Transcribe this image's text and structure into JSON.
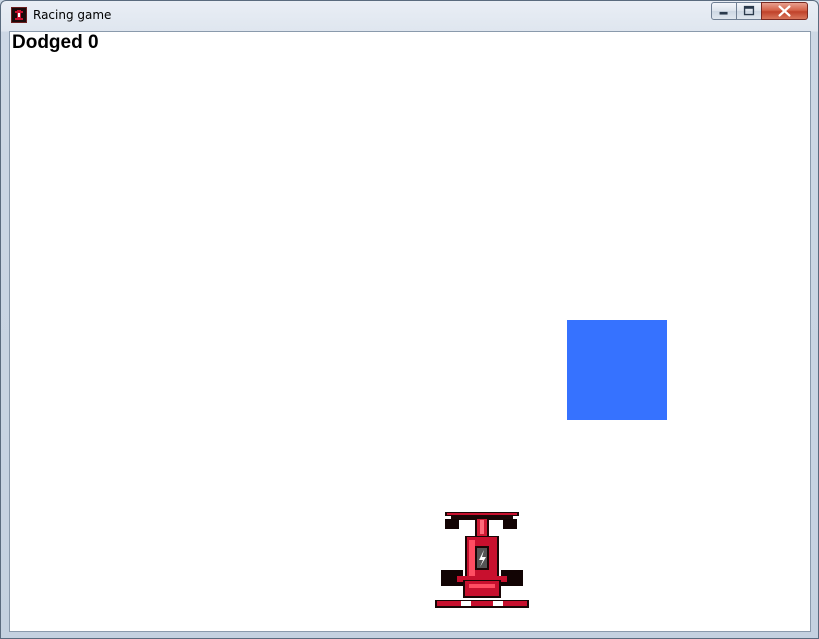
{
  "window": {
    "title": "Racing game",
    "app_icon": "race-car-icon",
    "controls": [
      "minimize",
      "maximize",
      "close"
    ]
  },
  "game": {
    "score_label": "Dodged",
    "score_value": "0",
    "obstacle_color": "#3672ff",
    "car_color": "#c8102e"
  }
}
